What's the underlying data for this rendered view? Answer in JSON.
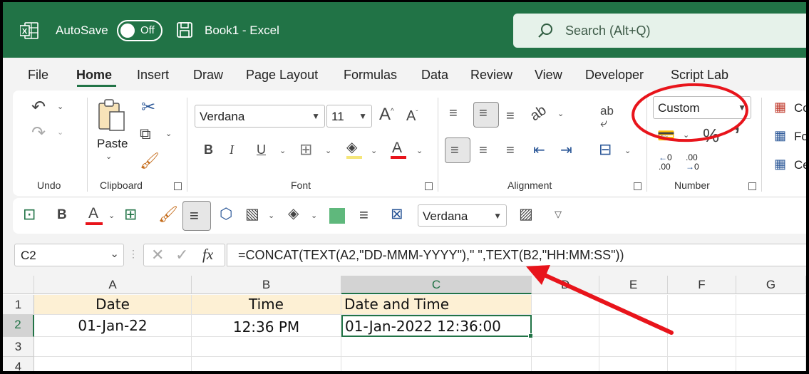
{
  "titlebar": {
    "autosave_label": "AutoSave",
    "autosave_state": "Off",
    "document_title": "Book1  -  Excel",
    "search_placeholder": "Search (Alt+Q)"
  },
  "tabs": [
    {
      "label": "File"
    },
    {
      "label": "Home",
      "active": true
    },
    {
      "label": "Insert"
    },
    {
      "label": "Draw"
    },
    {
      "label": "Page Layout"
    },
    {
      "label": "Formulas"
    },
    {
      "label": "Data"
    },
    {
      "label": "Review"
    },
    {
      "label": "View"
    },
    {
      "label": "Developer"
    },
    {
      "label": "Script Lab"
    }
  ],
  "ribbon": {
    "groups": {
      "undo": "Undo",
      "clipboard": "Clipboard",
      "font": "Font",
      "alignment": "Alignment",
      "number": "Number"
    },
    "paste_label": "Paste",
    "font_name": "Verdana",
    "font_size": "11",
    "number_format": "Custom",
    "styles_items": [
      "Co",
      "Fo",
      "Ce"
    ],
    "decimal_increase": ".00",
    "decimal_decrease": ".00",
    "decimal_zero": "0",
    "comma_glyph": "ʼ"
  },
  "qat": {
    "font_name": "Verdana"
  },
  "formula_bar": {
    "name_box": "C2",
    "fx_label": "fx",
    "formula": "=CONCAT(TEXT(A2,\"DD-MMM-YYYY\"),\" \",TEXT(B2,\"HH:MM:SS\"))"
  },
  "sheet": {
    "columns": [
      "A",
      "B",
      "C",
      "D",
      "E",
      "F",
      "G"
    ],
    "rows": [
      "1",
      "2",
      "3",
      "4"
    ],
    "header_row": [
      "Date",
      "Time",
      "Date and Time"
    ],
    "data_row": [
      "01-Jan-22",
      "12:36 PM",
      "01-Jan-2022 12:36:00"
    ],
    "active_cell": "C2"
  },
  "colors": {
    "excel_green": "#217346",
    "annotation_red": "#e8141b",
    "header_fill": "#fdf0d4"
  }
}
